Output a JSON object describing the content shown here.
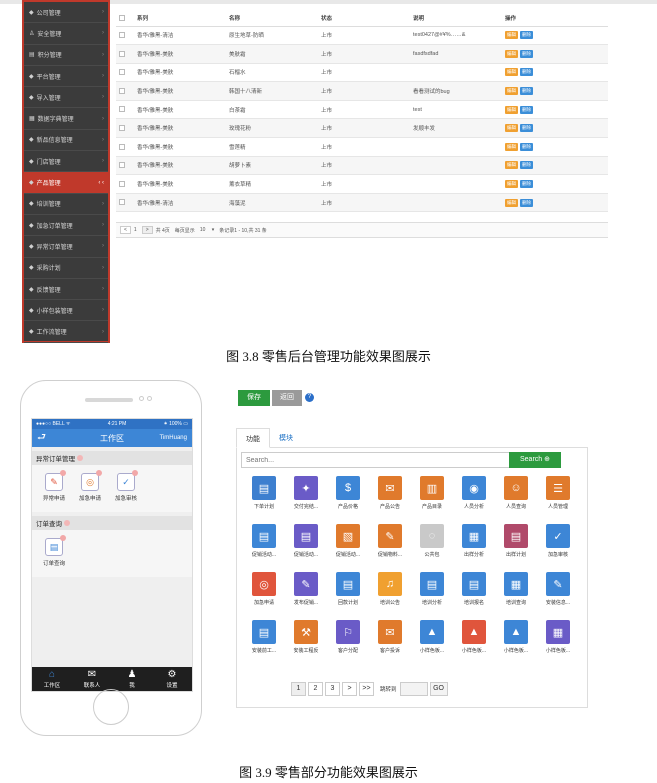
{
  "admin": {
    "sidebar": [
      {
        "icon": "◆",
        "label": "公司管理"
      },
      {
        "icon": "♙",
        "label": "安全管理"
      },
      {
        "icon": "▤",
        "label": "积分管理"
      },
      {
        "icon": "◆",
        "label": "平台管理"
      },
      {
        "icon": "◆",
        "label": "导入管理"
      },
      {
        "icon": "▦",
        "label": "数据字典管理"
      },
      {
        "icon": "◆",
        "label": "新品信息管理"
      },
      {
        "icon": "◆",
        "label": "门店管理"
      },
      {
        "icon": "◆",
        "label": "产品管理"
      },
      {
        "icon": "◆",
        "label": "培训管理"
      },
      {
        "icon": "◆",
        "label": "加急订单管理"
      },
      {
        "icon": "◆",
        "label": "异常订单管理"
      },
      {
        "icon": "◆",
        "label": "采购计划"
      },
      {
        "icon": "◆",
        "label": "反馈管理"
      },
      {
        "icon": "◆",
        "label": "小样包装管理"
      },
      {
        "icon": "◆",
        "label": "工作流管理"
      }
    ],
    "table": {
      "headers": [
        "系列",
        "名称",
        "状态",
        "说明",
        "操作"
      ],
      "edit_label": "编辑",
      "delete_label": "删除",
      "rows": [
        {
          "series": "香华/雅黑-清洁",
          "name": "原生地草-防晒",
          "status": "上市",
          "note": "test0427@#¥%……&"
        },
        {
          "series": "香华/雅黑-美肤",
          "name": "美肤霜",
          "status": "上市",
          "note": "fasdfsdfad"
        },
        {
          "series": "香华/雅黑-美肤",
          "name": "石榴水",
          "status": "上市",
          "note": ""
        },
        {
          "series": "香华/雅黑-美肤",
          "name": "韩国十八清新",
          "status": "上市",
          "note": "看看测试的bug"
        },
        {
          "series": "香华/雅黑-美肤",
          "name": "白茶霜",
          "status": "上市",
          "note": "test"
        },
        {
          "series": "香华/雅黑-美肤",
          "name": "玫瑰花粉",
          "status": "上市",
          "note": "发顺丰发"
        },
        {
          "series": "香华/雅黑-美肤",
          "name": "雪莲精",
          "status": "上市",
          "note": ""
        },
        {
          "series": "香华/雅黑-美肤",
          "name": "胡萝卜素",
          "status": "上市",
          "note": ""
        },
        {
          "series": "香华/雅黑-美肤",
          "name": "薰衣草精",
          "status": "上市",
          "note": ""
        },
        {
          "series": "香华/雅黑-清洁",
          "name": "海藻泥",
          "status": "上市",
          "note": ""
        }
      ]
    },
    "pager": {
      "prev": "<",
      "page": "1",
      "next": ">",
      "total": "共 4页",
      "per_page_label": "每页显示",
      "per_page": "10",
      "range": "条记录1 - 10,共 31 条"
    }
  },
  "caption_38": "图 3.8   零售后台管理功能效果图展示",
  "phone": {
    "carrier": "●●●○○ BELL ᯤ",
    "time": "4:21 PM",
    "battery": "⁕ 100% ▭",
    "back": "⮐",
    "title": "工作区",
    "user": "TimHuang",
    "sections": [
      {
        "title": "异常订单管理",
        "apps": [
          {
            "icon": "✎",
            "label": "异常申请",
            "color": "#e0553c"
          },
          {
            "icon": "◎",
            "label": "加急申请",
            "color": "#e07a2c"
          },
          {
            "icon": "✓",
            "label": "加急审核",
            "color": "#3d86d6"
          }
        ]
      },
      {
        "title": "订单查询",
        "apps": [
          {
            "icon": "▤",
            "label": "订单查询",
            "color": "#3d86d6"
          }
        ]
      }
    ],
    "tabs": [
      {
        "icon": "⌂",
        "label": "工作区"
      },
      {
        "icon": "✉",
        "label": "联系人"
      },
      {
        "icon": "♟",
        "label": "我"
      },
      {
        "icon": "⚙",
        "label": "设置"
      }
    ]
  },
  "panel": {
    "save": "保存",
    "back": "返回",
    "help": "?",
    "tabs": [
      "功能",
      "模块"
    ],
    "search_placeholder": "Search...",
    "search_btn": "Search ⊕",
    "functions": [
      {
        "label": "下单计划",
        "color": "#3d7fcf",
        "icon": "▤"
      },
      {
        "label": "交付完结...",
        "color": "#6a5bc7",
        "icon": "✦"
      },
      {
        "label": "产品价格",
        "color": "#3d86d6",
        "icon": "$"
      },
      {
        "label": "产品公告",
        "color": "#e07a2c",
        "icon": "✉"
      },
      {
        "label": "产品目录",
        "color": "#e07a2c",
        "icon": "▥"
      },
      {
        "label": "人员分析",
        "color": "#3d86d6",
        "icon": "◉"
      },
      {
        "label": "人员查询",
        "color": "#e07a2c",
        "icon": "☺"
      },
      {
        "label": "人员管理",
        "color": "#e07a2c",
        "icon": "☰"
      },
      {
        "label": "促销活动...",
        "color": "#3d86d6",
        "icon": "▤"
      },
      {
        "label": "促销活动...",
        "color": "#6a5bc7",
        "icon": "▤"
      },
      {
        "label": "促销活动...",
        "color": "#e07a2c",
        "icon": "▧"
      },
      {
        "label": "促销物料...",
        "color": "#e07a2c",
        "icon": "✎"
      },
      {
        "label": "公共包",
        "color": "#c9c9c9",
        "icon": "◌"
      },
      {
        "label": "出样分析",
        "color": "#3d86d6",
        "icon": "▦"
      },
      {
        "label": "出样计划",
        "color": "#b04a6a",
        "icon": "▤"
      },
      {
        "label": "加急审核",
        "color": "#3d86d6",
        "icon": "✓"
      },
      {
        "label": "加急申请",
        "color": "#e0553c",
        "icon": "◎"
      },
      {
        "label": "发布促销...",
        "color": "#6a5bc7",
        "icon": "✎"
      },
      {
        "label": "回款计划",
        "color": "#3d86d6",
        "icon": "▤"
      },
      {
        "label": "培训公告",
        "color": "#f0a030",
        "icon": "♫"
      },
      {
        "label": "培训分析",
        "color": "#3d86d6",
        "icon": "▤"
      },
      {
        "label": "培训报名",
        "color": "#3d86d6",
        "icon": "▤"
      },
      {
        "label": "培训查询",
        "color": "#3d86d6",
        "icon": "▦"
      },
      {
        "label": "安装信息...",
        "color": "#3d86d6",
        "icon": "✎"
      },
      {
        "label": "安装前工...",
        "color": "#3d86d6",
        "icon": "▤"
      },
      {
        "label": "安装工程反",
        "color": "#e07a2c",
        "icon": "⚒"
      },
      {
        "label": "客户分配",
        "color": "#6a5bc7",
        "icon": "⚐"
      },
      {
        "label": "客户投诉",
        "color": "#e07a2c",
        "icon": "✉"
      },
      {
        "label": "小样色板...",
        "color": "#3d86d6",
        "icon": "▲"
      },
      {
        "label": "小样色板...",
        "color": "#e0553c",
        "icon": "▲"
      },
      {
        "label": "小样色板...",
        "color": "#3d86d6",
        "icon": "▲"
      },
      {
        "label": "小样色板...",
        "color": "#6a5bc7",
        "icon": "▦"
      }
    ],
    "pager": {
      "pages": [
        "1",
        "2",
        "3",
        ">",
        ">>"
      ],
      "jump_label": "跳转到",
      "go": "GO"
    }
  },
  "caption_39": "图 3.9   零售部分功能效果图展示"
}
